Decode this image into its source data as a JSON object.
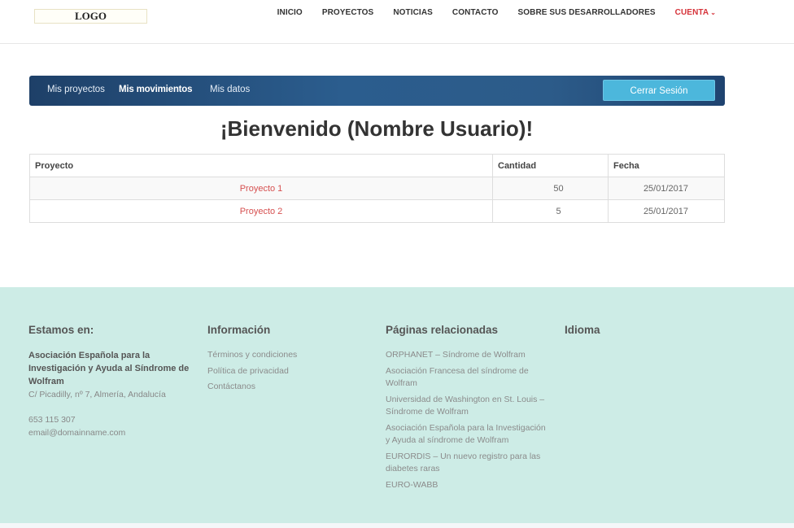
{
  "header": {
    "logo": "LOGO",
    "nav": [
      "INICIO",
      "PROYECTOS",
      "NOTICIAS",
      "CONTACTO",
      "SOBRE SUS DESARROLLADORES"
    ],
    "account": "CUENTA"
  },
  "account_bar": {
    "tabs": [
      "Mis proyectos",
      "Mis movimientos",
      "Mis datos"
    ],
    "active_tab": "Mis movimientos",
    "logout": "Cerrar Sesión"
  },
  "welcome": "¡Bienvenido (Nombre Usuario)!",
  "table": {
    "headers": [
      "Proyecto",
      "Cantidad",
      "Fecha"
    ],
    "rows": [
      {
        "proyecto": "Proyecto 1",
        "cantidad": "50",
        "fecha": "25/01/2017"
      },
      {
        "proyecto": "Proyecto 2",
        "cantidad": "5",
        "fecha": "25/01/2017"
      }
    ]
  },
  "footer": {
    "col1": {
      "title": "Estamos en:",
      "org": "Asociación Española para la Investigación y Ayuda al Síndrome de Wolfram",
      "address": "C/ Picadilly, nº 7, Almería, Andalucía",
      "phone": "653 115 307",
      "email": "email@domainname.com"
    },
    "col2": {
      "title": "Información",
      "links": [
        "Términos y condiciones",
        "Política de privacidad",
        "Contáctanos"
      ]
    },
    "col3": {
      "title": "Páginas relacionadas",
      "links": [
        "ORPHANET – Síndrome de Wolfram",
        "Asociación Francesa del síndrome de Wolfram",
        "Universidad de Washington en St. Louis – Síndrome de Wolfram",
        "Asociación Española para la Investigación y Ayuda al síndrome de Wolfram",
        "EURORDIS – Un nuevo registro para las diabetes raras",
        "EURO-WABB"
      ]
    },
    "col4": {
      "title": "Idioma"
    }
  },
  "colors": {
    "accent_red": "#d6333a",
    "footer_bg": "#cdece6",
    "button_blue": "#4cb7dc",
    "bar_blue": "#2b5d8e"
  }
}
